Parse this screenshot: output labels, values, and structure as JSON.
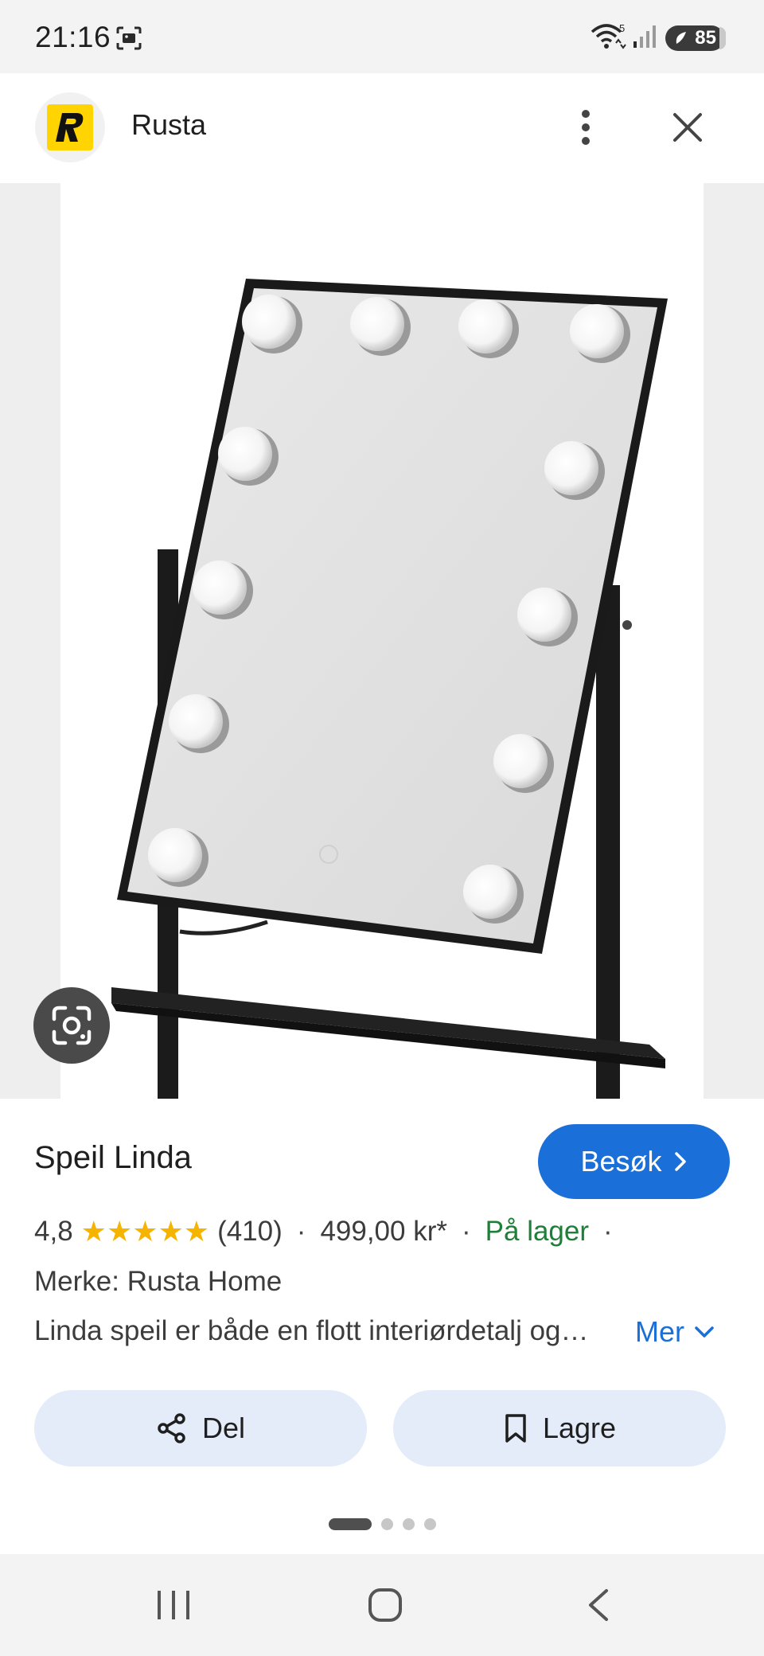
{
  "status_bar": {
    "time": "21:16",
    "battery": "85",
    "wifi_badge": "5"
  },
  "header": {
    "site_name": "Rusta",
    "logo_letter": "R"
  },
  "product": {
    "title": "Speil Linda",
    "visit_label": "Besøk",
    "rating": "4,8",
    "stars": 5,
    "review_count": "(410)",
    "separator": "·",
    "price": "499,00 kr*",
    "stock": "På lager",
    "brand": "Merke: Rusta Home",
    "description": "Linda speil er både en flott interiørdetalj og…",
    "more_label": "Mer"
  },
  "actions": {
    "share_label": "Del",
    "save_label": "Lagre"
  },
  "pager": {
    "count": 4,
    "active": 0
  },
  "colors": {
    "accent": "#1b6fd9",
    "stock_green": "#1e8038",
    "star": "#f5b400",
    "logo_yellow": "#ffd400"
  },
  "icons": {
    "header": [
      "more-vert-icon",
      "close-icon"
    ],
    "image": [
      "google-lens-icon"
    ],
    "nav": [
      "recent-apps-icon",
      "home-icon",
      "back-icon"
    ]
  }
}
